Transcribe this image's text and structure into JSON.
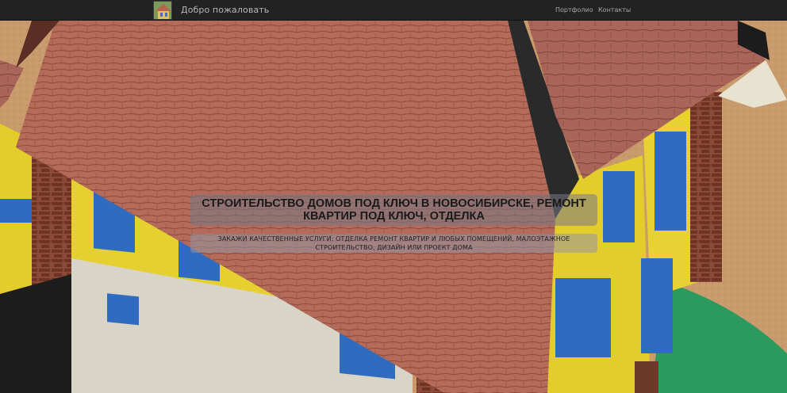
{
  "navbar": {
    "brand_label": "Добро пожаловать",
    "brand_logo_icon": "house-thumbnail-icon",
    "links": [
      {
        "label": "Портфолио"
      },
      {
        "label": "Контакты"
      }
    ]
  },
  "hero": {
    "headline": "СТРОИТЕЛЬСТВО ДОМОВ ПОД КЛЮЧ В НОВОСИБИРСКЕ, РЕМОНТ КВАРТИР ПОД КЛЮЧ, ОТДЕЛКА",
    "subline": "ЗАКАЖИ КАЧЕСТВЕННЫЕ УСЛУГИ: ОТДЕЛКА РЕМОНТ КВАРТИР И ЛЮБЫХ ПОМЕЩЕНИЙ, МАЛОЭТАЖНОЕ СТРОИТЕЛЬСТВО, ДИЗАЙН ИЛИ ПРОЕКТ ДОМА",
    "background_image": "paper-model-house-photo"
  },
  "colors": {
    "navbar_bg": "#222222",
    "roof": "#b06a58",
    "wall": "#e6cf2c",
    "shutter": "#2f6cc0",
    "brick": "#7a3b2a",
    "ground": "#2e9a5e"
  }
}
